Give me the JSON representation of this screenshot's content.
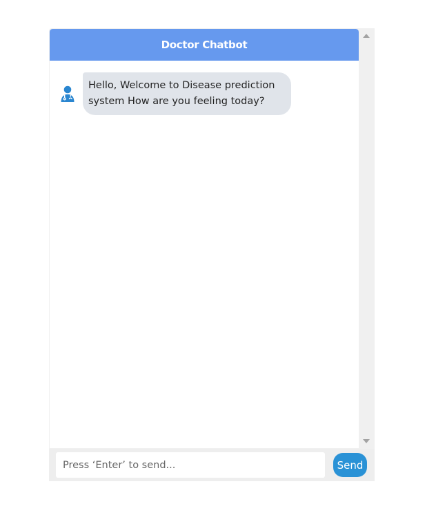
{
  "header": {
    "title": "Doctor Chatbot"
  },
  "messages": [
    {
      "sender": "bot",
      "avatar_icon": "doctor-icon",
      "text": "Hello, Welcome to Disease prediction system How are you feeling today?"
    }
  ],
  "input": {
    "placeholder": "Press ‘Enter’ to send...",
    "value": ""
  },
  "send_button": {
    "label": "Send"
  },
  "colors": {
    "header": "#6699ee",
    "bot_bubble": "#e0e4ea",
    "send_button": "#2a92d6",
    "avatar": "#2a86d0"
  }
}
